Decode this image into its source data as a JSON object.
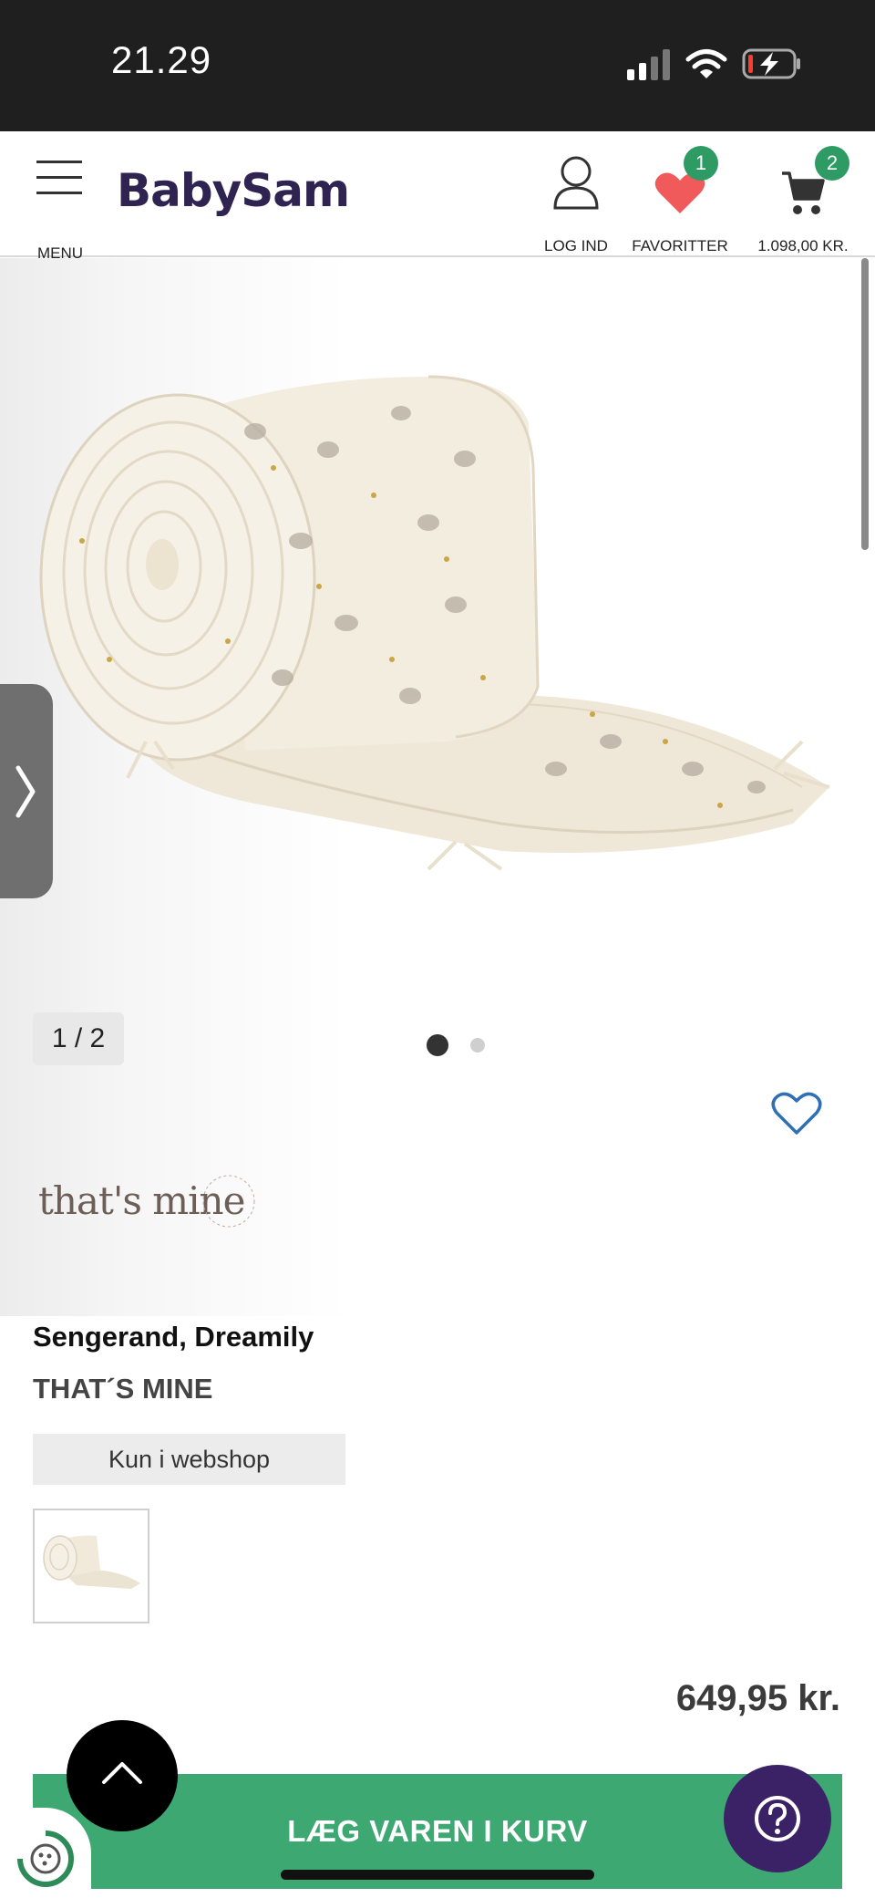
{
  "status_bar": {
    "time": "21.29"
  },
  "header": {
    "menu_label": "MENU",
    "logo": "BabySam",
    "login_label": "LOG IND",
    "favorites_label": "FAVORITTER",
    "favorites_count": "1",
    "cart_total": "1.098,00 KR.",
    "cart_count": "2"
  },
  "gallery": {
    "counter": "1 / 2",
    "brand_logo_text": "that's mine",
    "brand_logo_ring_text": "SLEEP DESIGNED IN DENMARK"
  },
  "product": {
    "title": "Sengerand, Dreamily",
    "brand": "THAT´S MINE",
    "availability": "Kun i webshop",
    "price": "649,95 kr."
  },
  "cta": {
    "add_to_cart": "LÆG VAREN I KURV"
  },
  "colors": {
    "brand_purple": "#2f2451",
    "cta_green": "#3ea873",
    "badge_green": "#2e9b64",
    "heart_red": "#f05a5a",
    "help_purple": "#3b2266",
    "wishlist_blue": "#2f6fb5"
  },
  "icons": [
    "hamburger-icon",
    "user-icon",
    "heart-icon",
    "cart-icon",
    "chevron-right-icon",
    "wishlist-heart-icon",
    "chevron-up-icon",
    "question-icon",
    "eco-icon"
  ]
}
